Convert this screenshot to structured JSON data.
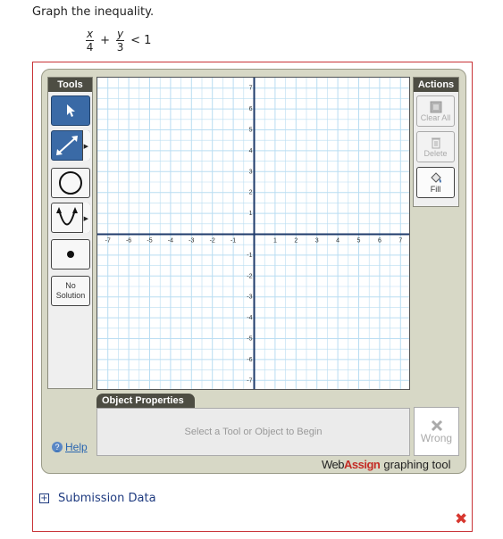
{
  "question": {
    "prompt": "Graph the inequality.",
    "formula": {
      "term1_num": "x",
      "term1_den": "4",
      "plus": "+",
      "term2_num": "y",
      "term2_den": "3",
      "rhs": "< 1"
    }
  },
  "tools": {
    "header": "Tools",
    "items": [
      {
        "name": "pointer",
        "icon": "cursor-arrow-icon",
        "active": true
      },
      {
        "name": "line",
        "icon": "double-arrow-line-icon",
        "has_submenu": true
      },
      {
        "name": "circle",
        "icon": "circle-icon"
      },
      {
        "name": "parabola",
        "icon": "parabola-icon",
        "has_submenu": true
      },
      {
        "name": "point",
        "icon": "point-dot-icon"
      },
      {
        "name": "no-solution",
        "label_line1": "No",
        "label_line2": "Solution"
      }
    ]
  },
  "graph": {
    "x_ticks": [
      "-7",
      "-6",
      "-5",
      "-4",
      "-3",
      "-2",
      "-1",
      "1",
      "2",
      "3",
      "4",
      "5",
      "6",
      "7"
    ],
    "y_ticks": [
      "7",
      "6",
      "5",
      "4",
      "3",
      "2",
      "1",
      "-1",
      "-2",
      "-3",
      "-4",
      "-5",
      "-6",
      "-7"
    ],
    "range": [
      -7.5,
      7.5
    ],
    "grid_color": "#b9ddf2",
    "axis_color": "#1f3b6b"
  },
  "actions": {
    "header": "Actions",
    "clear_all": "Clear All",
    "delete": "Delete",
    "fill": "Fill"
  },
  "object_properties": {
    "tab_label": "Object Properties",
    "placeholder": "Select a Tool or Object to Begin"
  },
  "status": {
    "wrong_label": "Wrong"
  },
  "help": {
    "icon_glyph": "?",
    "label": "Help"
  },
  "brand": {
    "web": "Web",
    "assign": "Assign",
    "suffix": "graphing tool"
  },
  "submission": {
    "label": "Submission Data",
    "toggle": "+"
  },
  "result": {
    "mark": "✖"
  }
}
